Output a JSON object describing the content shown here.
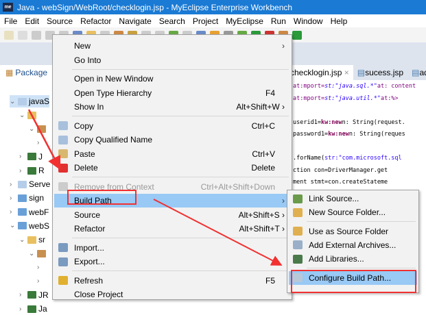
{
  "window": {
    "title": "Java - webSign/WebRoot/checklogin.jsp - MyEclipse Enterprise Workbench",
    "logo": "me"
  },
  "menubar": [
    "File",
    "Edit",
    "Source",
    "Refactor",
    "Navigate",
    "Search",
    "Project",
    "MyEclipse",
    "Run",
    "Window",
    "Help"
  ],
  "package_explorer": {
    "tab": "Package",
    "items": [
      {
        "label": "javaS",
        "chev": "v"
      },
      {
        "label": "",
        "chev": "v"
      },
      {
        "label": "",
        "chev": "v"
      },
      {
        "label": "",
        "chev": ">"
      },
      {
        "label": "J",
        "chev": ">"
      },
      {
        "label": "R",
        "chev": ">"
      },
      {
        "label": "Serve",
        "chev": ">"
      },
      {
        "label": "sign",
        "chev": ">"
      },
      {
        "label": "webF",
        "chev": ">"
      },
      {
        "label": "webS",
        "chev": "v"
      },
      {
        "label": "sr",
        "chev": "v"
      },
      {
        "label": "",
        "chev": "v"
      },
      {
        "label": "",
        "chev": ">"
      },
      {
        "label": "",
        "chev": ">"
      },
      {
        "label": "JR",
        "chev": ">"
      },
      {
        "label": "Ja",
        "chev": ">"
      }
    ]
  },
  "editor": {
    "tabs": [
      "checklogin.jsp",
      "sucess.jsp",
      "ad"
    ],
    "lines": [
      [
        "",
        "at:mport=",
        "st:\"java.sql.*\"",
        "at: content"
      ],
      [
        "",
        "at:mport=",
        "st:\"java.util.*\"",
        "at:%>"
      ],
      [
        ""
      ],
      [
        "userid1=",
        "kw:new",
        "n: String(request."
      ],
      [
        "password1=",
        "kw:new",
        "n: String(reques"
      ],
      [
        ""
      ],
      [
        ".forName(",
        "str:\"com.microsoft.sql"
      ],
      [
        "ction con=DriverManager.get"
      ],
      [
        "ment stmt=con.createStateme"
      ]
    ]
  },
  "context_menu": {
    "items": [
      {
        "label": "New",
        "arrow": "›"
      },
      {
        "label": "Go Into"
      },
      {
        "sep": true
      },
      {
        "label": "Open in New Window"
      },
      {
        "label": "Open Type Hierarchy",
        "shortcut": "F4"
      },
      {
        "label": "Show In",
        "shortcut": "Alt+Shift+W ›"
      },
      {
        "sep": true
      },
      {
        "label": "Copy",
        "shortcut": "Ctrl+C",
        "icon": "copy-icon"
      },
      {
        "label": "Copy Qualified Name",
        "icon": "copy-qualified-icon"
      },
      {
        "label": "Paste",
        "shortcut": "Ctrl+V",
        "icon": "paste-icon"
      },
      {
        "label": "Delete",
        "shortcut": "Delete",
        "icon": "delete-icon"
      },
      {
        "sep": true
      },
      {
        "label": "Remove from Context",
        "shortcut": "Ctrl+Alt+Shift+Down",
        "disabled": true,
        "icon": "remove-context-icon"
      },
      {
        "label": "Build Path",
        "arrow": "›",
        "highlighted": true
      },
      {
        "label": "Source",
        "shortcut": "Alt+Shift+S ›"
      },
      {
        "label": "Refactor",
        "shortcut": "Alt+Shift+T ›"
      },
      {
        "sep": true
      },
      {
        "label": "Import...",
        "icon": "import-icon"
      },
      {
        "label": "Export...",
        "icon": "export-icon"
      },
      {
        "sep": true
      },
      {
        "label": "Refresh",
        "shortcut": "F5",
        "icon": "refresh-icon"
      },
      {
        "label": "Close Project"
      }
    ]
  },
  "build_path_submenu": {
    "items": [
      {
        "label": "Link Source...",
        "icon": "link-source-icon"
      },
      {
        "label": "New Source Folder...",
        "icon": "new-source-folder-icon"
      },
      {
        "sep": true
      },
      {
        "label": "Use as Source Folder",
        "icon": "source-folder-icon"
      },
      {
        "label": "Add External Archives...",
        "icon": "jar-icon"
      },
      {
        "label": "Add Libraries...",
        "icon": "library-icon"
      },
      {
        "sep": true
      },
      {
        "label": "Configure Build Path...",
        "icon": "build-path-icon",
        "highlighted": true
      }
    ]
  },
  "colors": {
    "title": "#1a7ad4",
    "highlight": "#99c9f5",
    "annotation": "#f23030"
  }
}
